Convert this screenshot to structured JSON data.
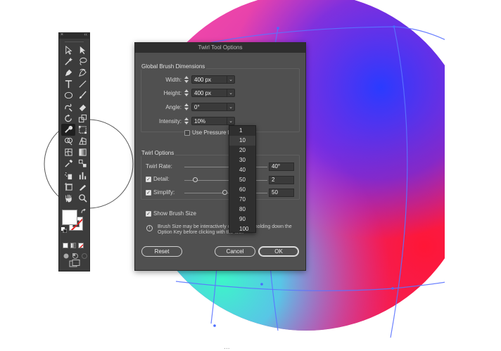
{
  "artwork": {
    "caption": "..."
  },
  "tools_panel": {
    "close_glyph": "×",
    "collapse_glyph": "‹‹",
    "tools": [
      "direct-selection-icon",
      "selection-icon",
      "magic-wand-icon",
      "lasso-icon",
      "pen-icon",
      "curvature-icon",
      "type-icon",
      "line-segment-icon",
      "ellipse-icon",
      "paintbrush-icon",
      "shaper-icon",
      "eraser-icon",
      "rotate-icon",
      "scale-icon",
      "twirl-icon",
      "free-transform-icon",
      "shape-builder-icon",
      "perspective-grid-icon",
      "mesh-icon",
      "gradient-icon",
      "eyedropper-icon",
      "blend-icon",
      "symbol-sprayer-icon",
      "column-graph-icon",
      "artboard-icon",
      "slice-icon",
      "hand-icon",
      "zoom-icon"
    ]
  },
  "dialog": {
    "title": "Twirl Tool Options",
    "global_section": {
      "title": "Global Brush Dimensions",
      "width": {
        "label": "Width:",
        "value": "400 px"
      },
      "height": {
        "label": "Height:",
        "value": "400 px"
      },
      "angle": {
        "label": "Angle:",
        "value": "0°"
      },
      "intensity": {
        "label": "Intensity:",
        "value": "10%"
      },
      "use_pressure_pen": {
        "label": "Use Pressure Pen",
        "checked": false
      }
    },
    "twirl_section": {
      "title": "Twirl Options",
      "twirl_rate": {
        "label": "Twirl Rate:",
        "value": "40°"
      },
      "detail": {
        "label": "Detail:",
        "value": "2",
        "checked": true
      },
      "simplify": {
        "label": "Simplify:",
        "value": "50",
        "checked": true
      }
    },
    "show_brush_size": {
      "label": "Show Brush Size",
      "checked": true
    },
    "info": "Brush Size may be interactively changed by holding down the Option Key before clicking with the tool.",
    "buttons": {
      "reset": "Reset",
      "cancel": "Cancel",
      "ok": "OK"
    }
  },
  "intensity_dropdown": {
    "options": [
      "1",
      "10",
      "20",
      "30",
      "40",
      "50",
      "60",
      "70",
      "80",
      "90",
      "100"
    ],
    "selected": "10"
  },
  "colors": {
    "panel_bg": "#3c3c3c",
    "dialog_bg": "#505050",
    "stroke_slash": "#e02020"
  }
}
